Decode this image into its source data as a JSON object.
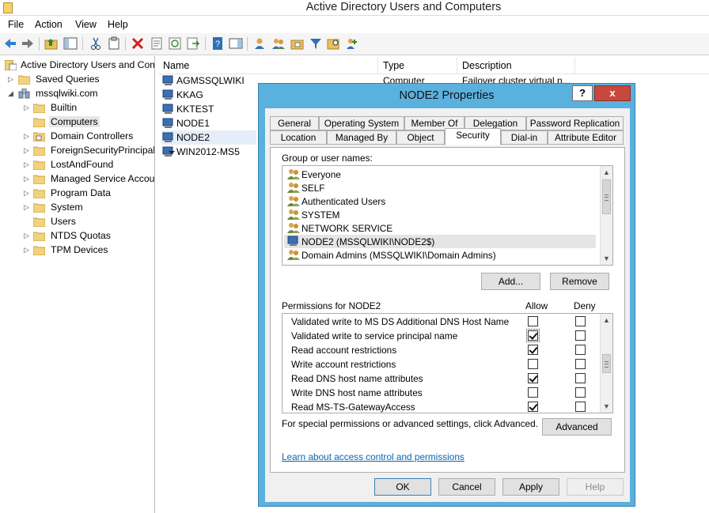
{
  "app": {
    "title": "Active Directory Users and Computers"
  },
  "menu": [
    "File",
    "Action",
    "View",
    "Help"
  ],
  "tree": [
    {
      "label": "Active Directory Users and Com",
      "icon": "ad-console-icon"
    },
    {
      "label": "Saved Queries",
      "icon": "folder-icon"
    },
    {
      "label": "mssqlwiki.com",
      "icon": "domain-icon"
    },
    {
      "label": "Builtin",
      "icon": "folder-icon"
    },
    {
      "label": "Computers",
      "icon": "folder-icon"
    },
    {
      "label": "Domain Controllers",
      "icon": "ou-folder-icon"
    },
    {
      "label": "ForeignSecurityPrincipals",
      "icon": "folder-icon"
    },
    {
      "label": "LostAndFound",
      "icon": "folder-icon"
    },
    {
      "label": "Managed Service Accour",
      "icon": "folder-icon"
    },
    {
      "label": "Program Data",
      "icon": "folder-icon"
    },
    {
      "label": "System",
      "icon": "folder-icon"
    },
    {
      "label": "Users",
      "icon": "folder-icon"
    },
    {
      "label": "NTDS Quotas",
      "icon": "folder-icon"
    },
    {
      "label": "TPM Devices",
      "icon": "folder-icon"
    }
  ],
  "list": {
    "columns": [
      "Name",
      "Type",
      "Description"
    ],
    "rows": [
      {
        "name": "AGMSSQLWIKI",
        "type": "Computer",
        "description": "Failover cluster virtual n..."
      },
      {
        "name": "KKAG"
      },
      {
        "name": "KKTEST"
      },
      {
        "name": "NODE1"
      },
      {
        "name": "NODE2"
      },
      {
        "name": "WIN2012-MS5"
      }
    ]
  },
  "dialog": {
    "title": "NODE2 Properties",
    "help_label": "?",
    "close_label": "x",
    "tabs_row1": [
      "General",
      "Operating System",
      "Member Of",
      "Delegation",
      "Password Replication"
    ],
    "tabs_row2": [
      "Location",
      "Managed By",
      "Object",
      "Security",
      "Dial-in",
      "Attribute Editor"
    ],
    "active_tab": "Security",
    "group_label": "Group or user names:",
    "groups": [
      "Everyone",
      "SELF",
      "Authenticated Users",
      "SYSTEM",
      "NETWORK SERVICE",
      "NODE2 (MSSQLWIKI\\NODE2$)",
      "Domain Admins (MSSQLWIKI\\Domain Admins)"
    ],
    "add_label": "Add...",
    "remove_label": "Remove",
    "permissions_label": "Permissions for NODE2",
    "allow_label": "Allow",
    "deny_label": "Deny",
    "permissions": [
      {
        "name": "Validated write to MS DS Additional DNS Host Name",
        "allow": false,
        "deny": false
      },
      {
        "name": "Validated write to service principal name",
        "allow": true,
        "deny": false
      },
      {
        "name": "Read account restrictions",
        "allow": true,
        "deny": false
      },
      {
        "name": "Write account restrictions",
        "allow": false,
        "deny": false
      },
      {
        "name": "Read DNS host name attributes",
        "allow": true,
        "deny": false
      },
      {
        "name": "Write DNS host name attributes",
        "allow": false,
        "deny": false
      },
      {
        "name": "Read MS-TS-GatewayAccess",
        "allow": true,
        "deny": false
      }
    ],
    "special_text": "For special permissions or advanced settings, click Advanced.",
    "advanced_label": "Advanced",
    "learn_link": "Learn about access control and permissions",
    "ok_label": "OK",
    "cancel_label": "Cancel",
    "apply_label": "Apply",
    "help_button_label": "Help"
  }
}
